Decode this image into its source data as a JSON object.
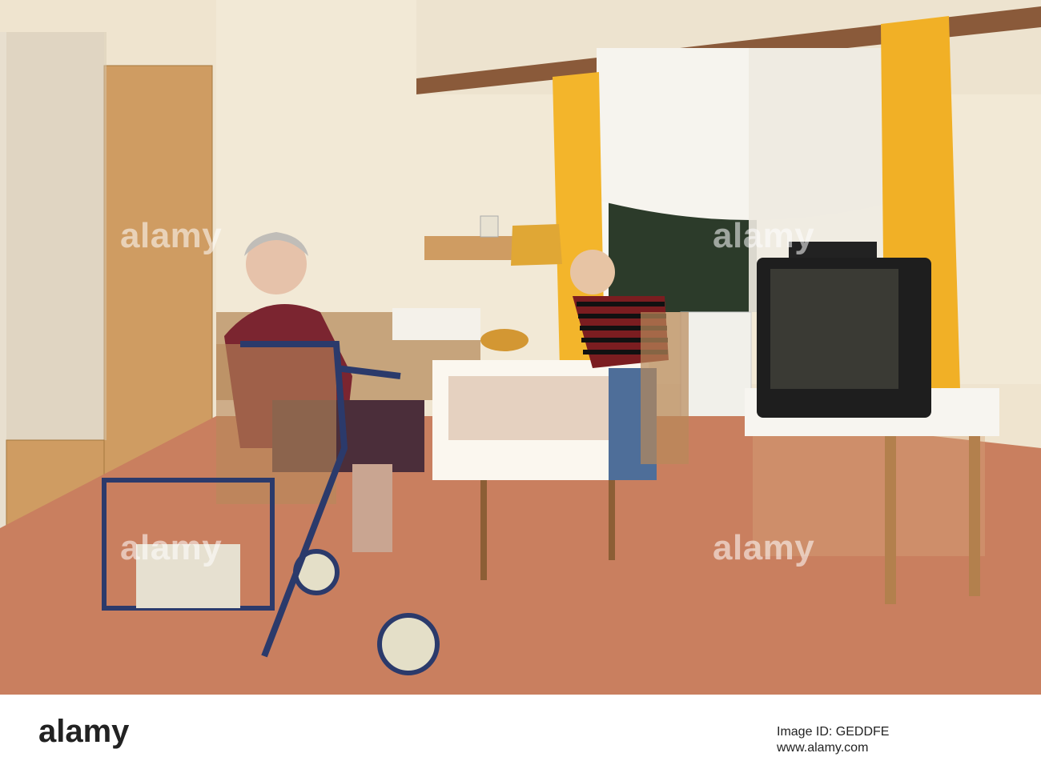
{
  "photo": {
    "description_hidden": false,
    "palette": {
      "wall": "#efe4cf",
      "carpet": "#c97f5f",
      "curtain_yellow": "#f3b52b",
      "wood": "#c99a61",
      "tv": "#1e1e1e",
      "table_cloth": "#fbf7ef"
    }
  },
  "watermarks": [
    "alamy",
    "alamy",
    "alamy",
    "alamy"
  ],
  "stock_bar": {
    "logo": "alamy",
    "image_id_label": "Image ID: GEDDFE",
    "url": "www.alamy.com"
  }
}
